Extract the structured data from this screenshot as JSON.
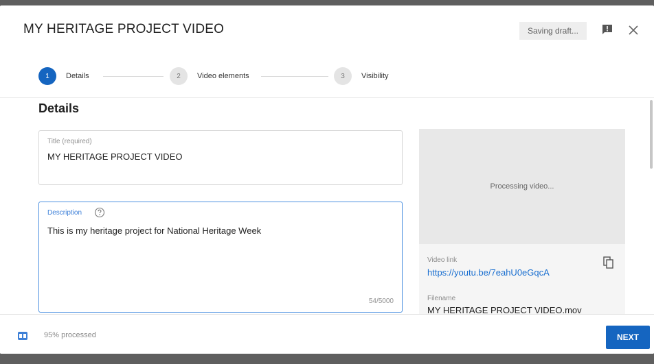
{
  "header": {
    "title": "MY HERITAGE PROJECT VIDEO",
    "saving_status": "Saving draft...",
    "feedback_icon": "feedback-icon",
    "close_icon": "close-icon"
  },
  "stepper": {
    "steps": [
      {
        "number": "1",
        "label": "Details",
        "active": true
      },
      {
        "number": "2",
        "label": "Video elements",
        "active": false
      },
      {
        "number": "3",
        "label": "Visibility",
        "active": false
      }
    ]
  },
  "details": {
    "section_title": "Details",
    "title_field": {
      "label": "Title (required)",
      "value": "MY HERITAGE PROJECT VIDEO"
    },
    "description_field": {
      "label": "Description",
      "value": "This is my heritage project for National Heritage Week",
      "char_count": "54/5000"
    }
  },
  "preview": {
    "status": "Processing video...",
    "video_link_label": "Video link",
    "video_link": "https://youtu.be/7eahU0eGqcA",
    "filename_label": "Filename",
    "filename": "MY HERITAGE PROJECT VIDEO.mov"
  },
  "footer": {
    "processed_text": "95% processed",
    "progress_percent": 95,
    "next_label": "NEXT"
  },
  "colors": {
    "accent": "#1565c0",
    "link": "#1a6fd0",
    "focus_border": "#4a8fe0"
  }
}
